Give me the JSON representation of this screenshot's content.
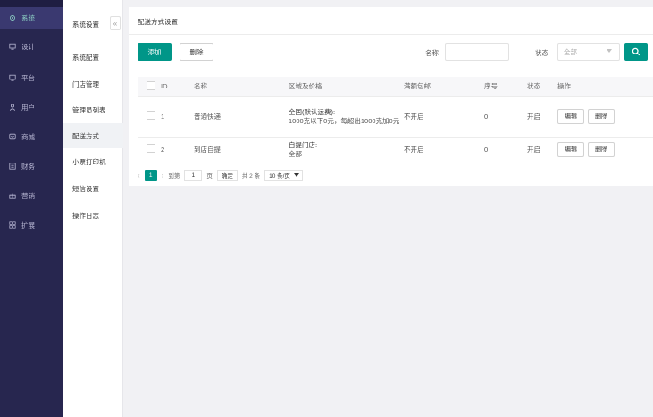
{
  "sidebar": {
    "items": [
      {
        "label": "系统",
        "icon": "gear-icon",
        "active": true
      },
      {
        "label": "设计",
        "icon": "monitor-icon"
      },
      {
        "label": "平台",
        "icon": "desktop-icon"
      },
      {
        "label": "用户",
        "icon": "user-icon"
      },
      {
        "label": "商城",
        "icon": "store-icon"
      },
      {
        "label": "财务",
        "icon": "finance-icon"
      },
      {
        "label": "营销",
        "icon": "gift-icon"
      },
      {
        "label": "扩展",
        "icon": "grid-icon"
      }
    ]
  },
  "subnav": {
    "items": [
      {
        "label": "系统设置"
      },
      {
        "label": "系统配置"
      },
      {
        "label": "门店管理"
      },
      {
        "label": "管理员列表"
      },
      {
        "label": "配送方式",
        "active": true
      },
      {
        "label": "小票打印机"
      },
      {
        "label": "短信设置"
      },
      {
        "label": "操作日志"
      }
    ],
    "collapse_glyph": "«"
  },
  "main": {
    "title": "配送方式设置",
    "toolbar": {
      "add_label": "添加",
      "delete_label": "删除",
      "name_label": "名称",
      "name_placeholder": "",
      "status_label": "状态",
      "status_value": "全部"
    },
    "table": {
      "headers": [
        "ID",
        "名称",
        "区域及价格",
        "满额包邮",
        "序号",
        "状态",
        "操作"
      ],
      "rows": [
        {
          "id": "1",
          "name": "普通快递",
          "region_title": "全国(默认运费):",
          "region_detail": "1000克以下0元，每超出1000克加0元",
          "free_shipping": "不开启",
          "order": "0",
          "status": "开启",
          "edit_label": "编辑",
          "delete_label": "删除"
        },
        {
          "id": "2",
          "name": "到店自提",
          "region_title": "自提门店:",
          "region_detail": "全部",
          "free_shipping": "不开启",
          "order": "0",
          "status": "开启",
          "edit_label": "编辑",
          "delete_label": "删除"
        }
      ]
    },
    "pagination": {
      "prev": "‹",
      "current_page": "1",
      "next": "›",
      "goto_label": "到第",
      "goto_value": "1",
      "page_unit": "页",
      "confirm_label": "确定",
      "total_label": "共 2 条",
      "page_size": "10 条/页"
    }
  },
  "colors": {
    "sidebar_bg": "#27264f",
    "primary": "#009688",
    "status_on": "#5fb878"
  }
}
